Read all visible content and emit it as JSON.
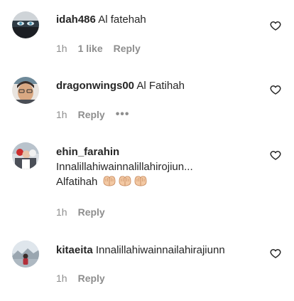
{
  "comments": [
    {
      "username": "idah486",
      "text": "Al fatehah",
      "time": "1h",
      "likes": "1 like",
      "reply": "Reply"
    },
    {
      "username": "dragonwings00",
      "text": "Al Fatihah",
      "time": "1h",
      "reply": "Reply",
      "more": "•••"
    },
    {
      "username": "ehin_farahin",
      "text_line1": "Innalillahiwainnalillahirojiun...",
      "text_line2": "Alfatihah",
      "emoji": "palms-up-together-icon",
      "time": "1h",
      "reply": "Reply"
    },
    {
      "username": "kitaeita",
      "text": "Innalillahiwainnailahirajiunn",
      "time": "1h",
      "reply": "Reply"
    }
  ],
  "colors": {
    "text": "#262626",
    "secondary": "#8e8e8e",
    "skin_emoji": "#f3c9a4"
  },
  "icons": {
    "like": "heart-outline-icon"
  }
}
